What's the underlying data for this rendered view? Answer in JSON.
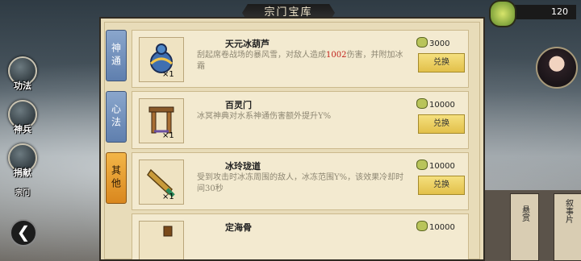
{
  "header": {
    "title": "宗门宝库",
    "currency_amount": "120"
  },
  "left_nav": [
    {
      "label": "功法"
    },
    {
      "label": "神兵"
    },
    {
      "label": "捐献"
    },
    {
      "label": "宗门"
    }
  ],
  "tabs": [
    {
      "label": "神通",
      "active": false
    },
    {
      "label": "心法",
      "active": false
    },
    {
      "label": "其他",
      "active": true
    }
  ],
  "items": [
    {
      "name": "天元冰葫芦",
      "count": "×1",
      "desc_pre": "刮起席卷战场的暴风雪，对敌人造成",
      "desc_highlight": "1002",
      "desc_post": "伤害，并附加冰霜",
      "price": "3000",
      "button": "兑换"
    },
    {
      "name": "百灵门",
      "count": "×1",
      "desc_pre": "冰冥神典对水系神通伤害额外提升Y%",
      "desc_highlight": "",
      "desc_post": "",
      "price": "10000",
      "button": "兑换"
    },
    {
      "name": "冰玲珑道",
      "count": "×1",
      "desc_pre": "受到攻击时冰冻周围的敌人，冰冻范围Y%，该效果冷却时间30秒",
      "desc_highlight": "",
      "desc_post": "",
      "price": "10000",
      "button": "兑换"
    },
    {
      "name": "定海骨",
      "count": "",
      "desc_pre": "",
      "desc_highlight": "",
      "desc_post": "",
      "price": "10000",
      "button": ""
    }
  ],
  "bottom_cards": [
    {
      "label": "悬赏"
    },
    {
      "label": "叙事片"
    }
  ],
  "colors": {
    "active_tab": "#f3b648",
    "tab": "#8aa6cc",
    "highlight": "#c0201a",
    "panel": "#e8dcb9"
  }
}
